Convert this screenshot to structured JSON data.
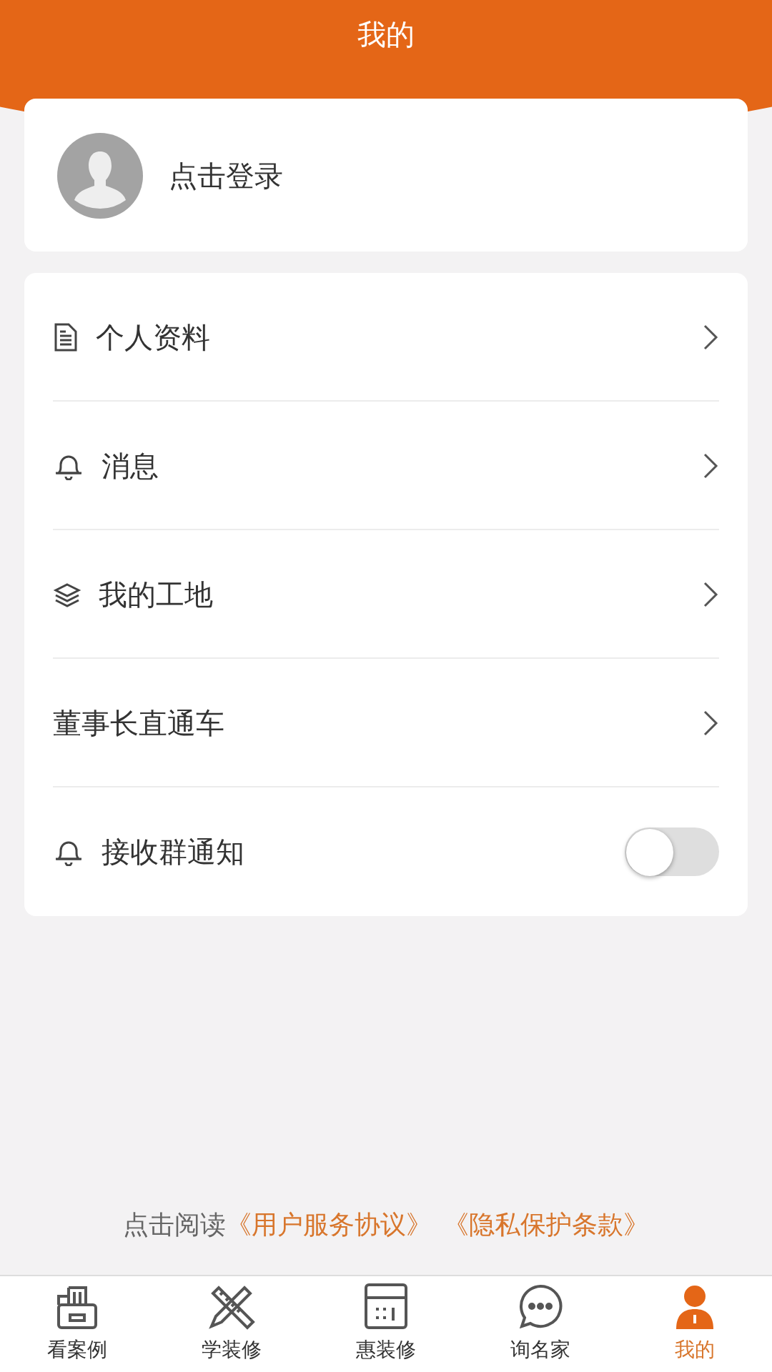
{
  "header": {
    "title": "我的"
  },
  "profile": {
    "login": "点击登录"
  },
  "menu": [
    {
      "kind": "link",
      "label": "个人资料"
    },
    {
      "kind": "link",
      "label": "消息"
    },
    {
      "kind": "link",
      "label": "我的工地"
    },
    {
      "kind": "link",
      "label": "董事长直通车"
    },
    {
      "kind": "toggle",
      "label": "接收群通知",
      "on": false
    }
  ],
  "agreement": {
    "prefix": "点击阅读",
    "links": [
      "《用户服务协议》",
      "《隐私保护条款》"
    ]
  },
  "tab_bar": [
    {
      "label": "看案例",
      "selected": false
    },
    {
      "label": "学装修",
      "selected": false
    },
    {
      "label": "惠装修",
      "selected": false
    },
    {
      "label": "询名家",
      "selected": false
    },
    {
      "label": "我的",
      "selected": true
    }
  ]
}
